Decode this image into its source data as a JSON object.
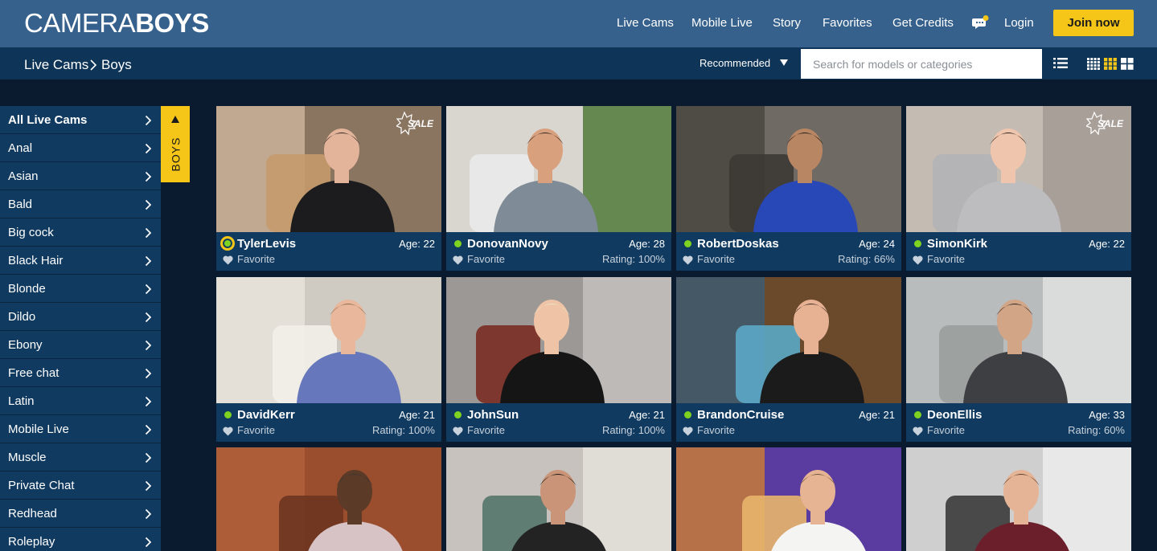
{
  "brand": {
    "logo_light": "CAMERA",
    "logo_bold": "BOYS"
  },
  "nav": {
    "items": [
      "Live Cams",
      "Mobile Live",
      "Story",
      "Favorites",
      "Get Credits"
    ],
    "login": "Login",
    "join": "Join now",
    "chat_icon": "chat-bubble-icon"
  },
  "breadcrumb": {
    "root": "Live Cams",
    "current": "Boys"
  },
  "toolbar": {
    "sort": "Recommended",
    "search_placeholder": "Search for models or categories"
  },
  "sidebar": {
    "items": [
      "All Live Cams",
      "Anal",
      "Asian",
      "Bald",
      "Big cock",
      "Black Hair",
      "Blonde",
      "Dildo",
      "Ebony",
      "Free chat",
      "Latin",
      "Mobile Live",
      "Muscle",
      "Private Chat",
      "Redhead",
      "Roleplay"
    ],
    "tab_label": "BOYS"
  },
  "models": [
    {
      "name": "TylerLevis",
      "age": "Age: 22",
      "favorite": "Favorite",
      "rating": "",
      "sale": "SALE"
    },
    {
      "name": "DonovanNovy",
      "age": "Age: 28",
      "favorite": "Favorite",
      "rating": "Rating: 100%",
      "sale": ""
    },
    {
      "name": "RobertDoskas",
      "age": "Age: 24",
      "favorite": "Favorite",
      "rating": "Rating: 66%",
      "sale": ""
    },
    {
      "name": "SimonKirk",
      "age": "Age: 22",
      "favorite": "Favorite",
      "rating": "",
      "sale": "SALE"
    },
    {
      "name": "DavidKerr",
      "age": "Age: 21",
      "favorite": "Favorite",
      "rating": "Rating: 100%",
      "sale": ""
    },
    {
      "name": "JohnSun",
      "age": "Age: 21",
      "favorite": "Favorite",
      "rating": "Rating: 100%",
      "sale": ""
    },
    {
      "name": "BrandonCruise",
      "age": "Age: 21",
      "favorite": "Favorite",
      "rating": "",
      "sale": ""
    },
    {
      "name": "DeonEllis",
      "age": "Age: 33",
      "favorite": "Favorite",
      "rating": "Rating: 60%",
      "sale": ""
    }
  ],
  "colors": {
    "topbar": "#35618c",
    "subbar": "#0e3457",
    "card": "#103a60",
    "accent": "#f5c518",
    "online": "#7ed321"
  }
}
